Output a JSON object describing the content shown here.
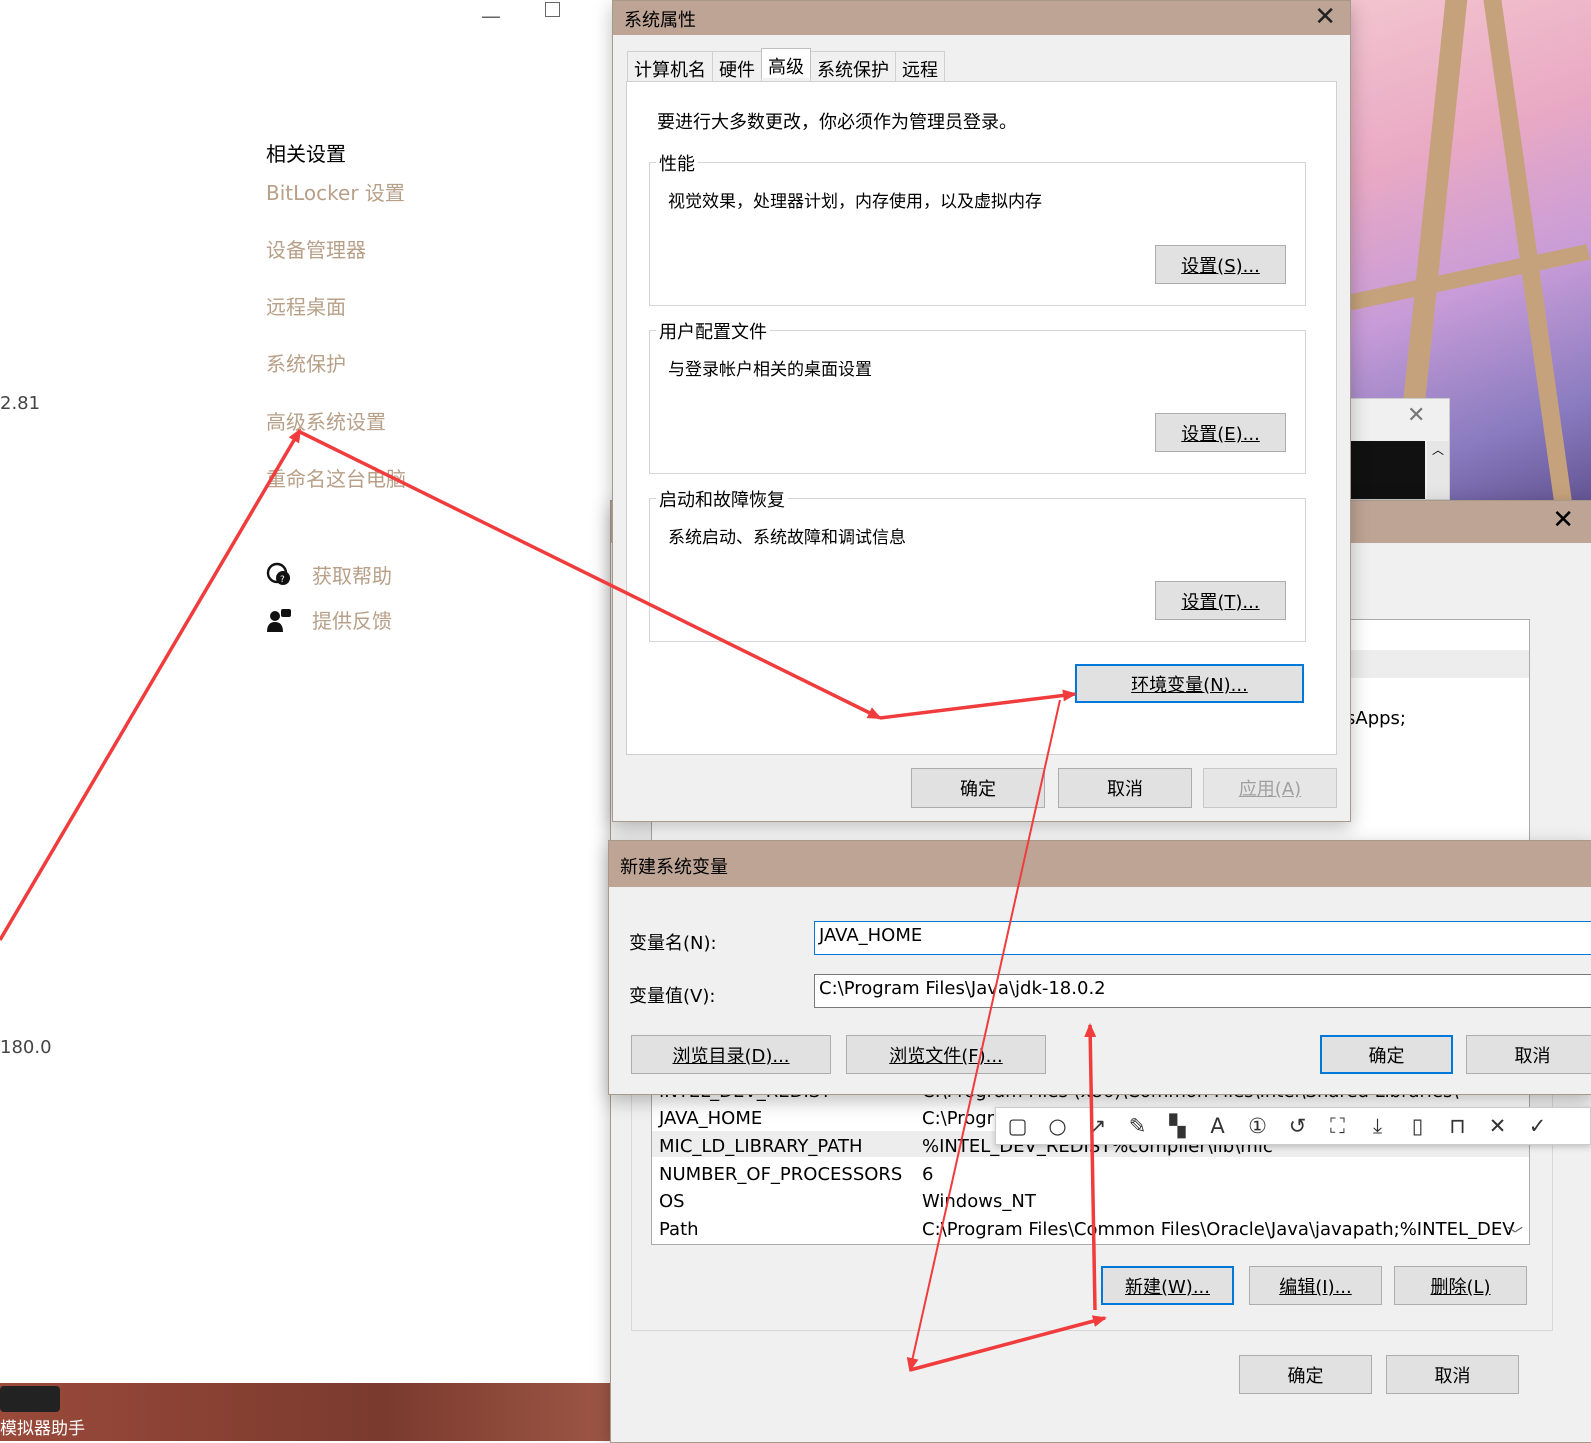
{
  "settings_app": {
    "related_title": "相关设置",
    "links": [
      "BitLocker 设置",
      "设备管理器",
      "远程桌面",
      "系统保护",
      "高级系统设置",
      "重命名这台电脑"
    ],
    "help": "获取帮助",
    "feedback": "提供反馈",
    "side_values": [
      "2.81",
      "180.0"
    ]
  },
  "sysprop": {
    "title": "系统属性",
    "tabs": [
      "计算机名",
      "硬件",
      "高级",
      "系统保护",
      "远程"
    ],
    "active_tab": "高级",
    "admin_note": "要进行大多数更改，你必须作为管理员登录。",
    "performance": {
      "label": "性能",
      "desc": "视觉效果，处理器计划，内存使用，以及虚拟内存",
      "button": "设置(S)..."
    },
    "profiles": {
      "label": "用户配置文件",
      "desc": "与登录帐户相关的桌面设置",
      "button": "设置(E)..."
    },
    "startup": {
      "label": "启动和故障恢复",
      "desc": "系统启动、系统故障和调试信息",
      "button": "设置(T)..."
    },
    "env_button": "环境变量(N)...",
    "ok": "确定",
    "cancel": "取消",
    "apply": "应用(A)"
  },
  "env_dialog": {
    "partial_text": "sApps;",
    "rows": [
      {
        "name": "INTEL_DEV_REDIST",
        "value": "C:\\Program Files (x86)\\Common Files\\Intel\\Shared Libraries\\"
      },
      {
        "name": "JAVA_HOME",
        "value": "C:\\Progra"
      },
      {
        "name": "MIC_LD_LIBRARY_PATH",
        "value": "%INTEL_DEV_REDIST%compiler\\lib\\mic"
      },
      {
        "name": "NUMBER_OF_PROCESSORS",
        "value": "6"
      },
      {
        "name": "OS",
        "value": "Windows_NT"
      },
      {
        "name": "Path",
        "value": "C:\\Program Files\\Common Files\\Oracle\\Java\\javapath;%INTEL_DEV"
      }
    ],
    "new_button": "新建(W)...",
    "edit_button": "编辑(I)...",
    "delete_button": "删除(L)",
    "ok": "确定",
    "cancel": "取消"
  },
  "new_var": {
    "title": "新建系统变量",
    "name_label": "变量名(N):",
    "name_value": "JAVA_HOME",
    "value_label": "变量值(V):",
    "value_value": "C:\\Program Files\\Java\\jdk-18.0.2",
    "browse_dir": "浏览目录(D)...",
    "browse_file": "浏览文件(F)...",
    "ok": "确定",
    "cancel": "取消"
  },
  "snip_toolbar": {
    "tools": [
      "rectangle-icon",
      "circle-icon",
      "arrow-icon",
      "pen-icon",
      "mosaic-icon",
      "text-icon",
      "number-icon",
      "undo-icon",
      "ocr-icon",
      "download-icon",
      "pin-icon",
      "bookmark-icon",
      "cancel-icon",
      "confirm-icon"
    ]
  },
  "taskbar": {
    "label": "模拟器助手"
  },
  "colors": {
    "titlebar": "#bea495",
    "annotation_arrow": "#f03c3c",
    "link": "#b8a088",
    "focus": "#0078d7"
  }
}
